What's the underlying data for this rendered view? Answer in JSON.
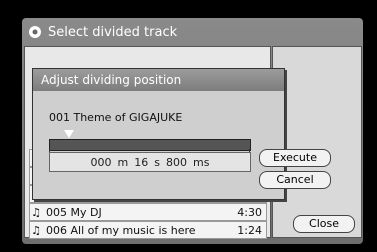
{
  "window": {
    "title": "Select divided track"
  },
  "tracks": [
    {
      "num": "005",
      "title": "My DJ",
      "time": "4:30"
    },
    {
      "num": "006",
      "title": "All of my music is here",
      "time": "1:24"
    }
  ],
  "close_label": "Close",
  "dialog": {
    "title": "Adjust dividing position",
    "track_name": "001 Theme of GIGAJUKE",
    "time": {
      "minutes": "000",
      "m_unit": "m",
      "seconds": "16",
      "s_unit": "s",
      "millis": "800",
      "ms_unit": "ms"
    },
    "execute_label": "Execute",
    "cancel_label": "Cancel"
  },
  "icons": [
    "note-icon",
    "speaker-icon"
  ]
}
